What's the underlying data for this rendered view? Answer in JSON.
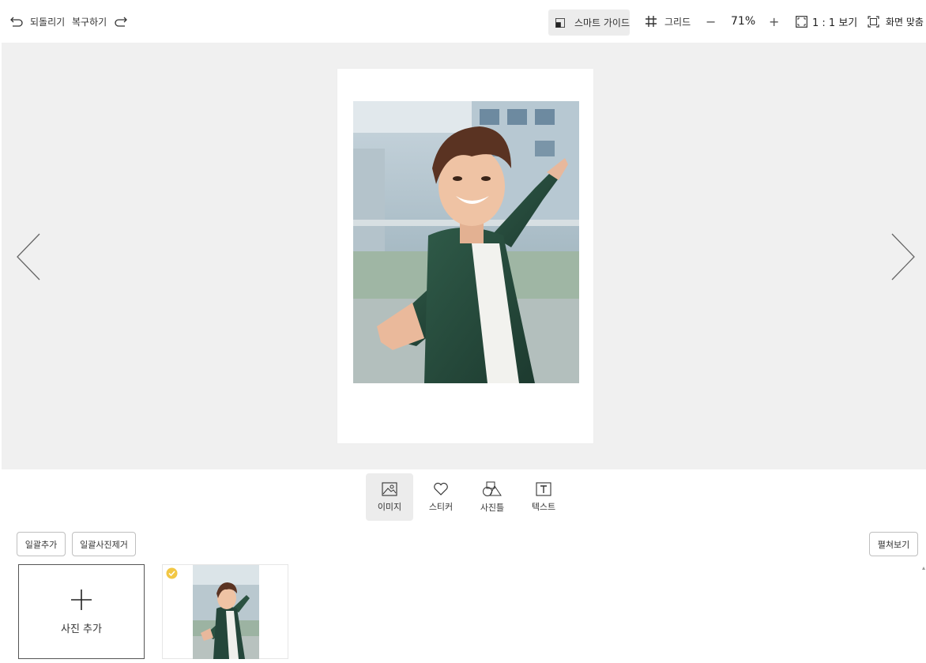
{
  "toolbar": {
    "undo_label": "되돌리기",
    "redo_label": "복구하기",
    "smart_guide_label": "스마트 가이드",
    "grid_label": "그리드",
    "zoom_out_label": "−",
    "zoom_value": "71%",
    "zoom_in_label": "+",
    "one_to_one_label": "1 : 1 보기",
    "fit_screen_label": "화면 맞춤"
  },
  "tools": [
    {
      "label": "이미지",
      "icon": "image-icon",
      "active": true
    },
    {
      "label": "스티커",
      "icon": "heart-icon",
      "active": false
    },
    {
      "label": "사진틀",
      "icon": "frame-shapes-icon",
      "active": false
    },
    {
      "label": "텍스트",
      "icon": "text-icon",
      "active": false
    }
  ],
  "photo_panel": {
    "bulk_add_label": "일괄추가",
    "bulk_remove_label": "일괄사진제거",
    "spread_view_label": "펼쳐보기",
    "add_photo_label": "사진 추가"
  },
  "colors": {
    "canvas_bg": "#f0f0f0",
    "active_tool_bg": "#ececec",
    "check_badge": "#f2c744"
  }
}
